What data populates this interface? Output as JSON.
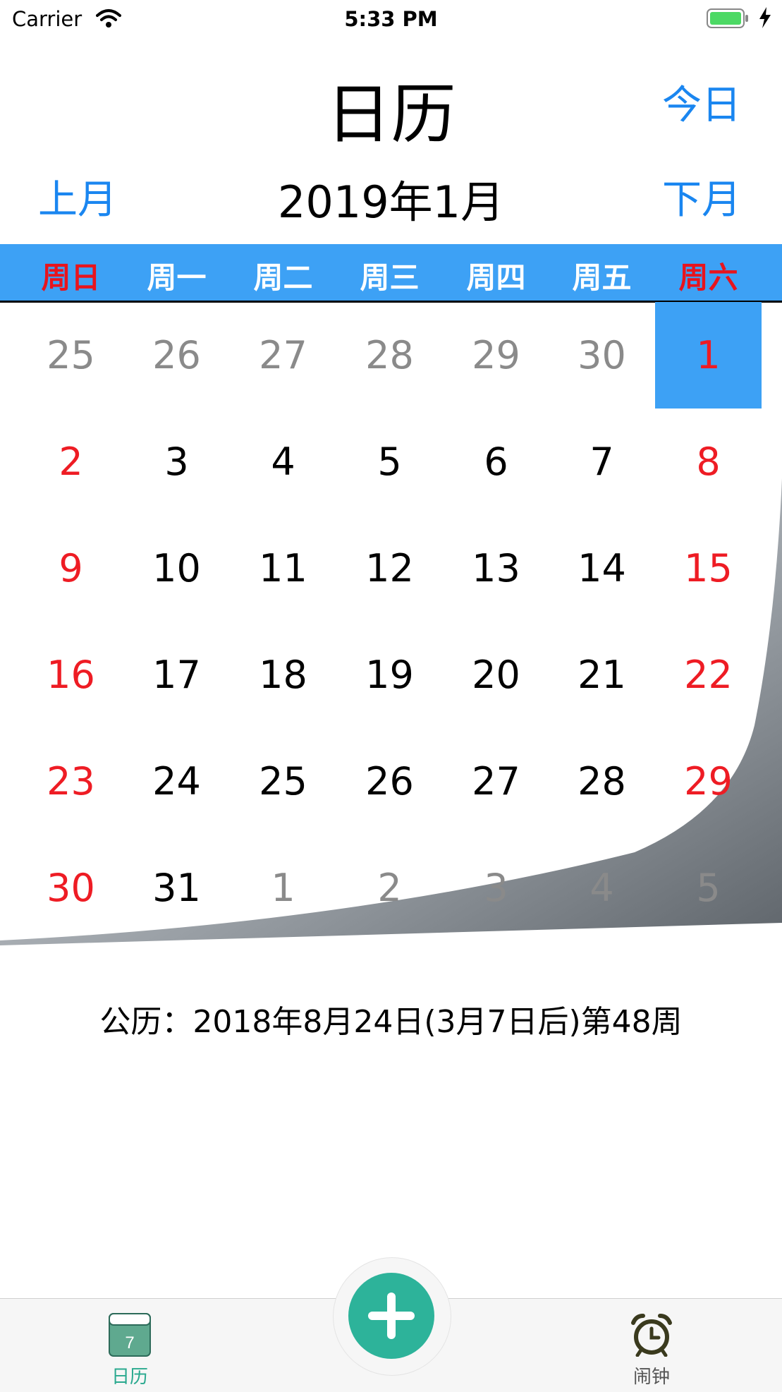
{
  "status_bar": {
    "carrier": "Carrier",
    "time": "5:33 PM",
    "wifi_icon": "wifi-icon",
    "battery_icon": "battery-icon",
    "charging_icon": "bolt-icon"
  },
  "header": {
    "title": "日历",
    "today_label": "今日"
  },
  "month_nav": {
    "prev_label": "上月",
    "month_label": "2019年1月",
    "next_label": "下月"
  },
  "weekdays": [
    "周日",
    "周一",
    "周二",
    "周三",
    "周四",
    "周五",
    "周六"
  ],
  "calendar": {
    "selected_day": "1",
    "rows": [
      [
        {
          "d": "25",
          "t": "other"
        },
        {
          "d": "26",
          "t": "other"
        },
        {
          "d": "27",
          "t": "other"
        },
        {
          "d": "28",
          "t": "other"
        },
        {
          "d": "29",
          "t": "other"
        },
        {
          "d": "30",
          "t": "other"
        },
        {
          "d": "1",
          "t": "weekend",
          "selected": true
        }
      ],
      [
        {
          "d": "2",
          "t": "weekend"
        },
        {
          "d": "3",
          "t": "cur"
        },
        {
          "d": "4",
          "t": "cur"
        },
        {
          "d": "5",
          "t": "cur"
        },
        {
          "d": "6",
          "t": "cur"
        },
        {
          "d": "7",
          "t": "cur"
        },
        {
          "d": "8",
          "t": "weekend"
        }
      ],
      [
        {
          "d": "9",
          "t": "weekend"
        },
        {
          "d": "10",
          "t": "cur"
        },
        {
          "d": "11",
          "t": "cur"
        },
        {
          "d": "12",
          "t": "cur"
        },
        {
          "d": "13",
          "t": "cur"
        },
        {
          "d": "14",
          "t": "cur"
        },
        {
          "d": "15",
          "t": "weekend"
        }
      ],
      [
        {
          "d": "16",
          "t": "weekend"
        },
        {
          "d": "17",
          "t": "cur"
        },
        {
          "d": "18",
          "t": "cur"
        },
        {
          "d": "19",
          "t": "cur"
        },
        {
          "d": "20",
          "t": "cur"
        },
        {
          "d": "21",
          "t": "cur"
        },
        {
          "d": "22",
          "t": "weekend"
        }
      ],
      [
        {
          "d": "23",
          "t": "weekend"
        },
        {
          "d": "24",
          "t": "cur"
        },
        {
          "d": "25",
          "t": "cur"
        },
        {
          "d": "26",
          "t": "cur"
        },
        {
          "d": "27",
          "t": "cur"
        },
        {
          "d": "28",
          "t": "cur"
        },
        {
          "d": "29",
          "t": "weekend"
        }
      ],
      [
        {
          "d": "30",
          "t": "weekend"
        },
        {
          "d": "31",
          "t": "cur"
        },
        {
          "d": "1",
          "t": "other"
        },
        {
          "d": "2",
          "t": "other"
        },
        {
          "d": "3",
          "t": "other"
        },
        {
          "d": "4",
          "t": "other"
        },
        {
          "d": "5",
          "t": "other"
        }
      ]
    ]
  },
  "info_text": "公历：2018年8月24日(3月7日后)第48周",
  "tab_bar": {
    "calendar_label": "日历",
    "calendar_icon_text": "7",
    "alarm_label": "闹钟",
    "add_icon": "plus-icon"
  },
  "colors": {
    "accent_blue": "#1a86f0",
    "weekday_bar": "#3da1f5",
    "weekend_red": "#ee1c24",
    "fab_green": "#2db39a"
  }
}
